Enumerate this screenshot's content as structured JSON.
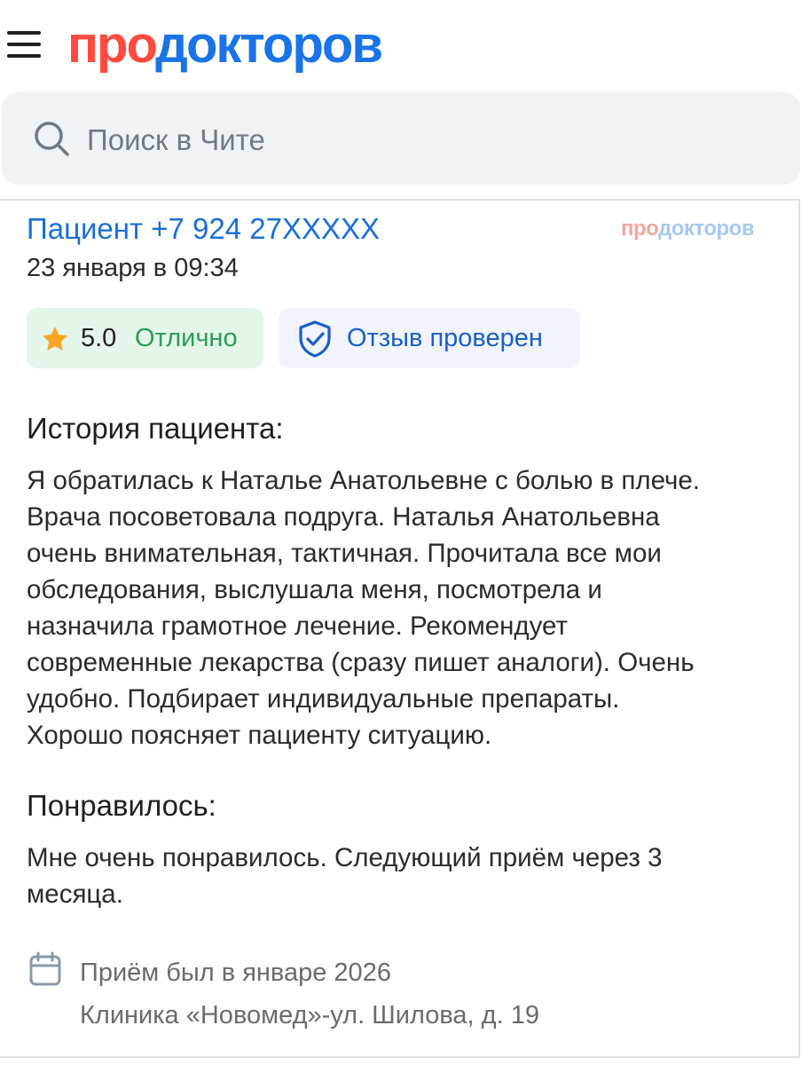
{
  "header": {
    "logo_part1": "про",
    "logo_part2": "докторов",
    "brand_colors": {
      "pro": "#ff4a3d",
      "doctors": "#1a73e8"
    },
    "menu_icon": "hamburger-menu-icon"
  },
  "search": {
    "placeholder": "Поиск в Чите",
    "icon": "search-icon"
  },
  "review": {
    "author": "Пациент +7 924 27XXXXX",
    "watermark_part1": "про",
    "watermark_part2": "докторов",
    "date": "23 января в 09:34",
    "rating": {
      "value": "5.0",
      "label": "Отлично",
      "icon": "star-icon",
      "color": "#2a9d55"
    },
    "verified": {
      "label": "Отзыв проверен",
      "icon": "shield-check-icon"
    },
    "history": {
      "title": "История пациента:",
      "lines": [
        "Я обратилась к Наталье Анатольевне с болью в плече.",
        "Врача посоветовала подруга. Наталья Анатольевна",
        "очень внимательная, тактичная. Прочитала все мои",
        "обследования, выслушала меня, посмотрела и",
        "назначила грамотное лечение. Рекомендует",
        "современные лекарства (сразу пишет аналоги). Очень",
        "удобно. Подбирает индивидуальные препараты.",
        "Хорошо поясняет пациенту ситуацию."
      ]
    },
    "liked": {
      "title": "Понравилось:",
      "lines": [
        "Мне очень понравилось. Следующий приём через 3",
        "месяца."
      ]
    },
    "visit": {
      "when": "Приём был в январе 2026",
      "clinic": "Клиника «Новомед»-ул. Шилова, д. 19",
      "icon": "calendar-icon"
    }
  }
}
